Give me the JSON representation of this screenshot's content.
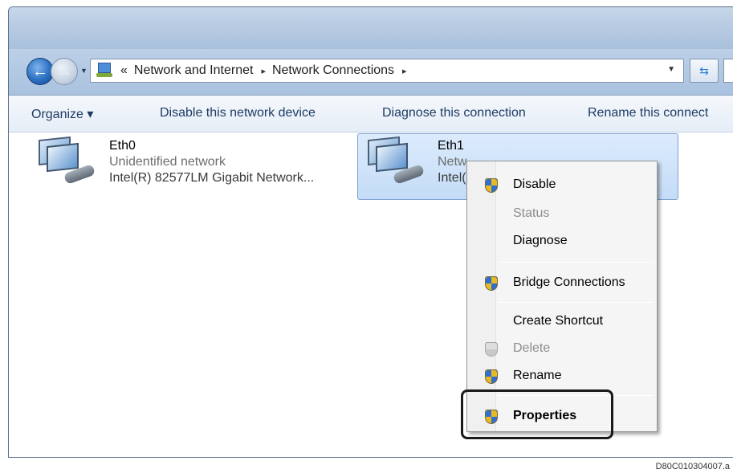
{
  "navigation": {
    "address_overflow": "«",
    "breadcrumb": [
      "Network and Internet",
      "Network Connections"
    ],
    "separator": "▸"
  },
  "command_bar": {
    "organize": "Organize ▾",
    "disable": "Disable this network device",
    "diagnose": "Diagnose this connection",
    "rename": "Rename this connect"
  },
  "connections": [
    {
      "name": "Eth0",
      "status": "Unidentified network",
      "device": "Intel(R) 82577LM Gigabit Network..."
    },
    {
      "name": "Eth1",
      "status": "Netw",
      "device": "Intel("
    }
  ],
  "context_menu": {
    "items": [
      {
        "label": "Disable",
        "icon": "shield-icon",
        "enabled": true
      },
      {
        "label": "Status",
        "icon": "",
        "enabled": false
      },
      {
        "label": "Diagnose",
        "icon": "",
        "enabled": true
      },
      {
        "label": "Bridge Connections",
        "icon": "shield-icon",
        "enabled": true
      },
      {
        "label": "Create Shortcut",
        "icon": "",
        "enabled": true
      },
      {
        "label": "Delete",
        "icon": "shield-icon",
        "enabled": false
      },
      {
        "label": "Rename",
        "icon": "shield-icon",
        "enabled": true
      },
      {
        "label": "Properties",
        "icon": "shield-icon",
        "enabled": true,
        "bold": true
      }
    ]
  },
  "figure_code": "D80C010304007.a"
}
